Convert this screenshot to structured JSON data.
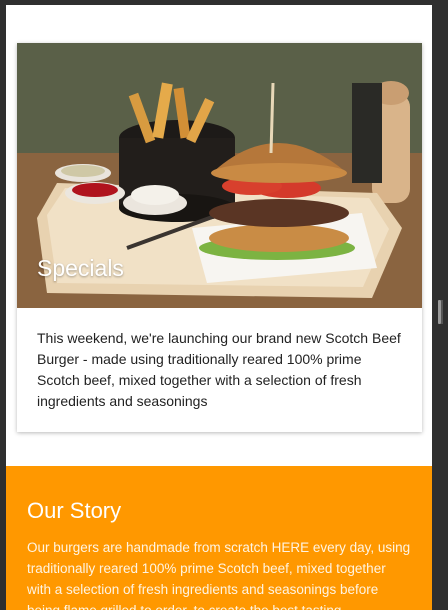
{
  "specials": {
    "title": "Specials",
    "image_alt": "burger-with-fries-photo",
    "body": "This weekend, we're launching our brand new Scotch Beef Burger - made using traditionally reared 100% prime Scotch beef, mixed together with a selection of fresh ingredients and seasonings"
  },
  "our_story": {
    "title": "Our Story",
    "body": "Our burgers are handmade from scratch HERE every day, using traditionally reared 100% prime Scotch beef, mixed together with a selection of fresh ingredients and seasonings before being flame grilled to order, to create the best tasting"
  },
  "colors": {
    "accent": "#ff9800",
    "background": "#ffffff"
  }
}
